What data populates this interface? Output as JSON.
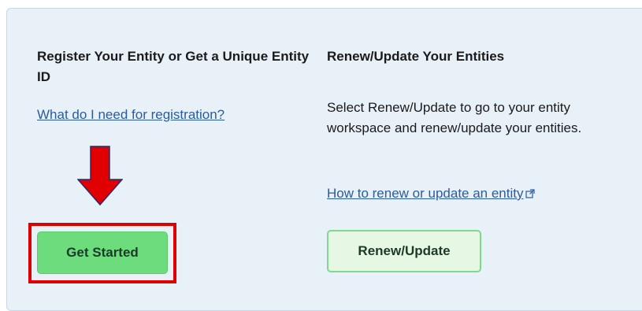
{
  "left_column": {
    "title": "Register Your Entity or Get a Unique Entity ID",
    "link_text": "What do I need for registration?",
    "button_label": "Get Started"
  },
  "right_column": {
    "title": "Renew/Update Your Entities",
    "description": "Select Renew/Update to go to your entity workspace and renew/update your entities.",
    "link_text": "How to renew or update an entity",
    "link_icon": "external-link-icon",
    "button_label": "Renew/Update"
  },
  "annotations": {
    "arrow_color": "#e10000",
    "highlight_color": "#e10000"
  },
  "colors": {
    "panel_bg": "#e8f0f8",
    "primary_button": "#6ddc7c",
    "secondary_button_bg": "#e6f7e4",
    "link": "#2b5c9e"
  }
}
